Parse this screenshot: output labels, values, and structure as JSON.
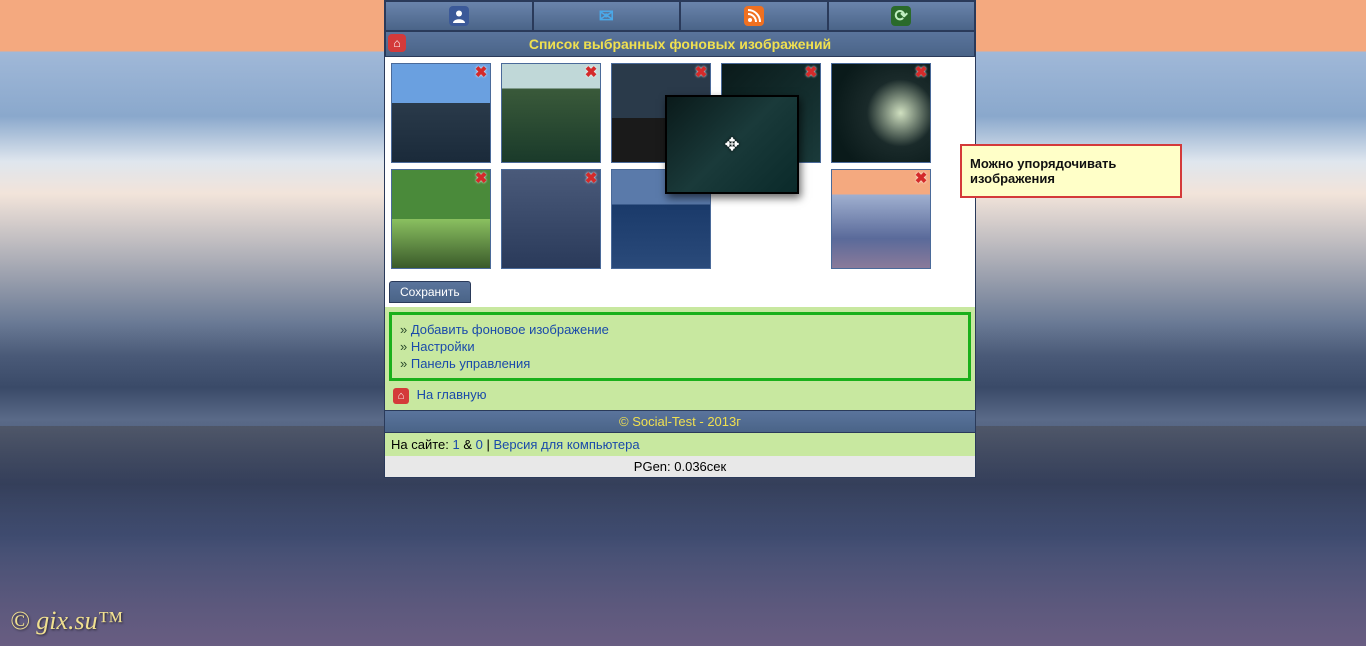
{
  "topnav": {
    "items": [
      "profile",
      "mail",
      "rss",
      "reload"
    ]
  },
  "title": "Список выбранных фоновых изображений",
  "thumbs": {
    "row1": [
      "city-skyline",
      "pine-forest",
      "city-night-street",
      "dark-forest",
      "tunnel"
    ],
    "row2": [
      "green-tree-alley",
      "rainy-street",
      "ocean-sunset",
      "mountain-river"
    ]
  },
  "drag_thumb_name": "dark-forest",
  "save_button": "Сохранить",
  "links": {
    "add_bg": "Добавить фоновое изображение",
    "settings": "Настройки",
    "control_panel": "Панель управления"
  },
  "home_link": "На главную",
  "footer_copyright": "© Social-Test - 2013г",
  "footer_status": {
    "prefix": "На сайте: ",
    "n1": "1",
    "amp": " & ",
    "n2": "0",
    "sep": " | ",
    "desktop_version": "Версия для компьютера"
  },
  "pgen": "PGen: 0.036сек",
  "callout": "Можно упорядочивать изображения",
  "watermark": "© gix.su™"
}
